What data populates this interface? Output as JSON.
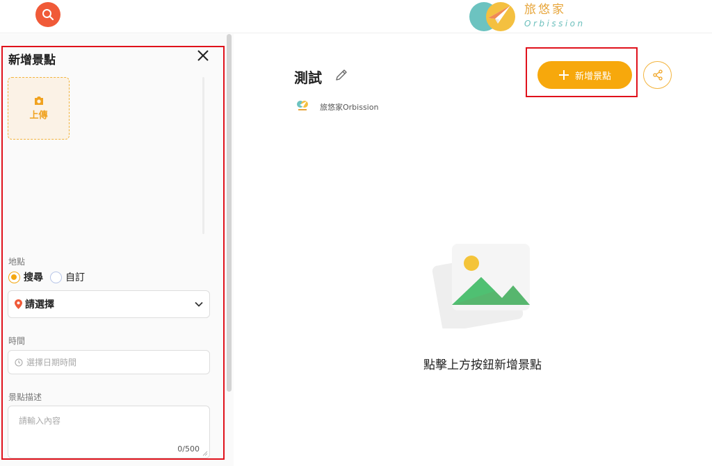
{
  "header": {
    "search_icon": "search-icon",
    "logo_cn": "旅悠家",
    "logo_en": "Orbission"
  },
  "panel": {
    "title": "新增景點",
    "upload_label": "上傳",
    "location_label": "地點",
    "radio_options": [
      {
        "label": "搜尋",
        "selected": true
      },
      {
        "label": "自訂",
        "selected": false
      }
    ],
    "select_placeholder": "請選擇",
    "time_label": "時間",
    "time_placeholder": "選擇日期時間",
    "desc_label": "景點描述",
    "desc_placeholder": "請輸入內容",
    "desc_counter": "0/500"
  },
  "main": {
    "title": "測試",
    "author": "旅悠家Orbission",
    "add_button": "新增景點",
    "empty_text": "點擊上方按鈕新增景點"
  },
  "colors": {
    "accent": "#f7a80c",
    "search_btn": "#f05a38",
    "highlight": "#e0111b"
  }
}
